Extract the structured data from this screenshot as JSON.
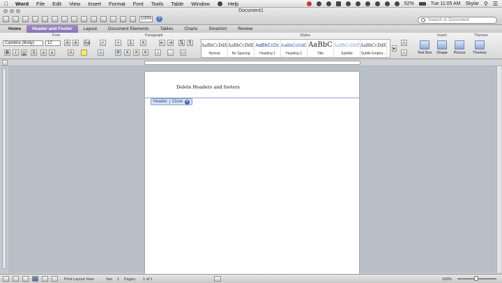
{
  "menubar": {
    "apple": "",
    "items": [
      "Word",
      "File",
      "Edit",
      "View",
      "Insert",
      "Format",
      "Font",
      "Tools",
      "Table",
      "Window",
      "Help"
    ],
    "clock": "Tue 11:05 AM",
    "battery": "52%",
    "user": "Skylar"
  },
  "window": {
    "title": "Document1",
    "zoom": "100%",
    "search_placeholder": "Search in Document"
  },
  "ribbon": {
    "tabs": [
      "Home",
      "Header and Footer",
      "Layout",
      "Document Elements",
      "Tables",
      "Charts",
      "SmartArt",
      "Review"
    ],
    "groups": {
      "font": "Font",
      "paragraph": "Paragraph",
      "styles": "Styles",
      "insert": "Insert",
      "themes": "Themes"
    },
    "font_name": "Cambria (Body)",
    "font_size": "12",
    "styles": [
      {
        "sample": "AaBbCcDdEe",
        "name": "Normal",
        "cls": ""
      },
      {
        "sample": "AaBbCcDdEe",
        "name": "No Spacing",
        "cls": ""
      },
      {
        "sample": "AaBbCcDc",
        "name": "Heading 1",
        "cls": "h1"
      },
      {
        "sample": "AaBbCcDdEe",
        "name": "Heading 2",
        "cls": "h2"
      },
      {
        "sample": "AaBbC",
        "name": "Title",
        "cls": "title"
      },
      {
        "sample": "AaBbCcDdE",
        "name": "Subtitle",
        "cls": "sub"
      },
      {
        "sample": "AaBbCcDdEe",
        "name": "Subtle Empha...",
        "cls": ""
      }
    ],
    "insert_items": [
      "Text Box",
      "Shape",
      "Picture"
    ],
    "themes_label": "Themes"
  },
  "document": {
    "header_text": "Delete Headers and footers",
    "header_tag": "Header",
    "close_label": "Close"
  },
  "statusbar": {
    "view_name": "Print Layout View",
    "sec_label": "Sec",
    "sec_value": "1",
    "pages_label": "Pages:",
    "pages_value": "1 of 1",
    "zoom": "100%"
  }
}
